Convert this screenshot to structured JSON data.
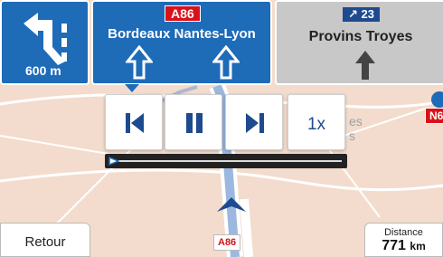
{
  "signs": {
    "turn": {
      "distance": "600 m"
    },
    "direction": {
      "road": "A86",
      "destinations": "Bordeaux Nantes-Lyon"
    },
    "secondary": {
      "road": "↗ 23",
      "destinations": "Provins Troyes"
    }
  },
  "player": {
    "speed": "1x"
  },
  "bottom": {
    "back_label": "Retour",
    "distance_caption": "Distance",
    "distance_value": "771",
    "distance_unit": "km",
    "current_road": "A86"
  },
  "map": {
    "road_label_right": "N6"
  },
  "colors": {
    "sign_blue": "#1e6bb8",
    "road_red": "#d9121a",
    "map_bg": "#f3dccd"
  }
}
